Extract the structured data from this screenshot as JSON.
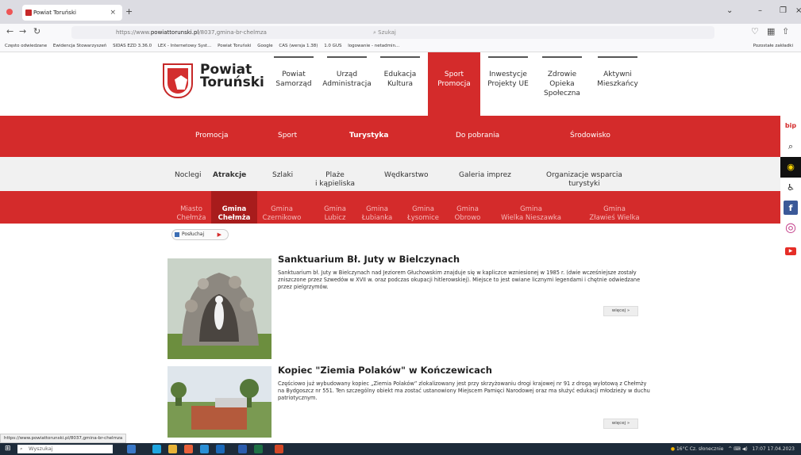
{
  "browser": {
    "tab_title": "Powiat Toruński",
    "tab_close": "×",
    "new_tab": "+",
    "url_prefix": "https://www.",
    "url_domain": "powiattorunski.pl",
    "url_path": "/8037,gmina-br-chelmza",
    "search_placeholder": "Szukaj",
    "bookmarks": [
      "Często odwiedzane",
      "Ewidencja Stowarzyszeń",
      "SIDAS EZD 3.36.0",
      "LEX - Internetowy Syst...",
      "Powiat Toruński",
      "Google",
      "CAS (wersja 1.38)",
      "1.0 GUS",
      "logowanie - netadmin..."
    ],
    "bookmarks_other": "Pozostałe zakładki",
    "status_url": "https://www.powiattorunski.pl/8037,gmina-br-chelmza"
  },
  "site": {
    "logo_line1": "Powiat",
    "logo_line2": "Toruński",
    "top_nav": [
      {
        "label": "Powiat\nSamorząd"
      },
      {
        "label": "Urząd\nAdministracja"
      },
      {
        "label": "Edukacja\nKultura"
      },
      {
        "label": "Sport\nPromocja"
      },
      {
        "label": "Inwestycje\nProjekty UE"
      },
      {
        "label": "Zdrowie\nOpieka\nSpołeczna"
      },
      {
        "label": "Aktywni\nMieszkańcy"
      }
    ],
    "red_menu": [
      "Promocja",
      "Sport",
      "Turystyka",
      "Do pobrania",
      "Środowisko"
    ],
    "gray_menu": [
      "Noclegi",
      "Atrakcje",
      "Szlaki",
      "Plaże\ni kąpieliska",
      "Wędkarstwo",
      "Galeria imprez",
      "Organizacje wsparcia\nturystyki"
    ],
    "gmina_menu": [
      "Miasto\nChełmża",
      "Gmina\nChełmża",
      "Gmina\nCzernikowo",
      "Gmina\nLubicz",
      "Gmina\nŁubianka",
      "Gmina\nŁysomice",
      "Gmina\nObrowo",
      "Gmina\nWielka Nieszawka",
      "Gmina\nZławieś Wielka"
    ],
    "side_icons": {
      "bip": "bip",
      "search": "⌕",
      "contrast": "◉",
      "accessibility": "♿",
      "facebook": "f",
      "instagram": "◎",
      "youtube": "▶"
    },
    "listen_label": "Posłuchaj",
    "more_label": "więcej »",
    "articles": [
      {
        "title": "Sanktuarium Bł. Juty w Bielczynach",
        "text": "Sanktuarium bł. Juty w Bielczynach nad Jeziorem Głuchowskim znajduje się w kapliczce wzniesionej w 1985 r. (dwie wcześniejsze zostały zniszczone przez Szwedów w XVII w. oraz podczas okupacji hitlerowskiej). Miejsce to jest owiane licznymi legendami i chętnie odwiedzane przez pielgrzymów."
      },
      {
        "title": "Kopiec \"Ziemia Polaków\" w Kończewicach",
        "text": "Częściowo już wybudowany kopiec „Ziemia Polaków” zlokalizowany jest przy skrzyżowaniu drogi krajowej nr 91 z drogą wylotową z Chełmży na Bydgoszcz nr 551. Ten szczególny obiekt ma zostać ustanowiony Miejscem Pamięci Narodowej oraz ma służyć edukacji młodzieży w duchu patriotycznym."
      }
    ]
  },
  "taskbar": {
    "search_placeholder": "Wyszukaj",
    "weather": "16°C  Cz. słonecznie",
    "time": "17:07",
    "date": "17.04.2023"
  },
  "colors": {
    "brand_red": "#d42b2b",
    "dark_red": "#a81c1c"
  }
}
